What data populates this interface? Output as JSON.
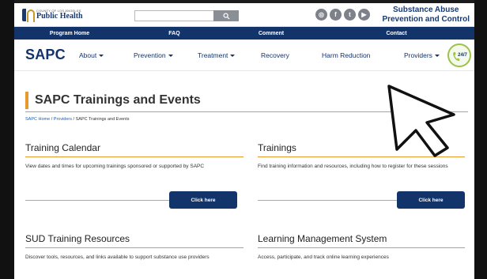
{
  "header": {
    "logo_small": "COUNTY OF LOS ANGELES",
    "logo_big": "Public Health",
    "agency_line1": "Substance Abuse",
    "agency_line2": "Prevention and Control",
    "socials": [
      {
        "icon": "instagram-icon",
        "glyph": "◎"
      },
      {
        "icon": "facebook-icon",
        "glyph": "f"
      },
      {
        "icon": "twitter-icon",
        "glyph": "t"
      },
      {
        "icon": "youtube-icon",
        "glyph": "▶"
      }
    ]
  },
  "topnav": [
    "Program Home",
    "FAQ",
    "Comment",
    "Contact"
  ],
  "mainnav": {
    "brand": "SAPC",
    "items": [
      "About",
      "Prevention",
      "Treatment",
      "Recovery",
      "Harm Reduction",
      "Providers"
    ],
    "hotline": "24/7"
  },
  "page": {
    "title": "SAPC Trainings and Events",
    "breadcrumb": {
      "home": "SAPC Home",
      "sep1": " / ",
      "providers": "Providers",
      "sep2": " / ",
      "current": "SAPC Trainings and Events"
    }
  },
  "cards": [
    {
      "title": "Training Calendar",
      "desc": "View dates and times for upcoming trainings sponsored or supported by SAPC",
      "button": "Click here"
    },
    {
      "title": "Trainings",
      "desc": "Find training information and resources, including how to register for these sessions",
      "button": "Click here"
    },
    {
      "title": "SUD Training Resources",
      "desc": "Discover tools, resources, and links available to support substance use providers",
      "button": ""
    },
    {
      "title": "Learning Management System",
      "desc": "Access, participate, and track online learning experiences",
      "button": ""
    }
  ],
  "colors": {
    "navy": "#13336b",
    "accent": "#e69a2e",
    "green": "#9cc34a"
  }
}
